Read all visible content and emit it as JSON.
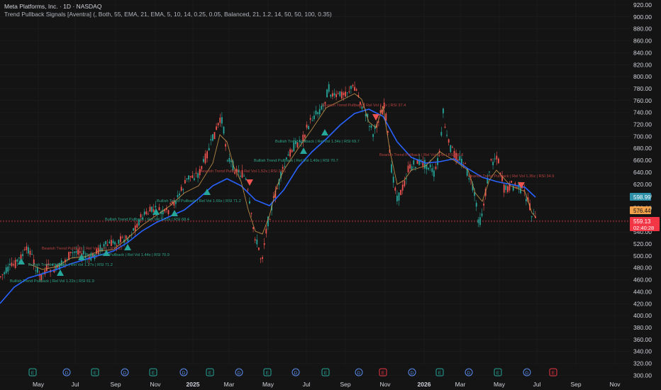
{
  "header": {
    "title": "Meta Platforms, Inc. · 1D · NASDAQ",
    "indicator": "Trend Pullback Signals [Aventra] (, Both, 55, EMA, 21, EMA, 5, 10, 14, 0.25, 0.05, Balanced, 21, 1.2, 14, 50, 50, 100, 0.35)"
  },
  "price_axis": {
    "ticks": [
      "920.00",
      "900.00",
      "880.00",
      "860.00",
      "840.00",
      "820.00",
      "800.00",
      "780.00",
      "760.00",
      "740.00",
      "720.00",
      "700.00",
      "680.00",
      "660.00",
      "640.00",
      "620.00",
      "600.00",
      "580.00",
      "560.00",
      "540.00",
      "520.00",
      "500.00",
      "480.00",
      "460.00",
      "440.00",
      "420.00",
      "400.00",
      "380.00",
      "360.00",
      "340.00",
      "320.00",
      "300.00"
    ],
    "badges": [
      {
        "text": "598.99",
        "color": "#2e8fa8"
      },
      {
        "text": "576.44",
        "color": "#f0a04a"
      },
      {
        "text": "559.13",
        "color": "#f23645"
      },
      {
        "text": "02:40:28",
        "color": "#f23645"
      }
    ]
  },
  "time_axis": {
    "labels": [
      "May",
      "Jul",
      "Sep",
      "Nov",
      "2025",
      "Mar",
      "May",
      "Jul",
      "Sep",
      "Nov",
      "2026",
      "Mar",
      "May",
      "Jul",
      "Sep",
      "Nov"
    ]
  },
  "events": [
    "E",
    "D",
    "E",
    "D",
    "E",
    "D",
    "E",
    "D",
    "E",
    "D",
    "E",
    "D",
    "E",
    "D",
    "E",
    "D",
    "E",
    "D",
    "E"
  ],
  "signals": [
    {
      "text": "Bearish Trend Pullback | Rel Vol 1.3x | RSI 37.4",
      "color": "#b9423f"
    },
    {
      "text": "Bullish Trend Pullback | Rel Vol 1.34x | RSI 69.7",
      "color": "#2ea58a"
    },
    {
      "text": "Bullish Trend Pullback | Rel Vol 1.49x | RSI 70.7",
      "color": "#2ea58a"
    },
    {
      "text": "Bearish Trend Pullback | Rel Vol 1.52x | RSI 29.1",
      "color": "#b9423f"
    },
    {
      "text": "Bullish Trend Pullback | Rel Vol 1.66x | RSI 71.2",
      "color": "#2ea58a"
    },
    {
      "text": "Bullish Trend Pullback | Rel Vol 1.53x | RSI 68.4",
      "color": "#2ea58a"
    },
    {
      "text": "Bullish Trend Pullback | Rel Vol 1.44x | RSI 70.9",
      "color": "#2ea58a"
    },
    {
      "text": "Bearish Trend Pullback | Rel Vol 1.3x | RSI 32",
      "color": "#b9423f"
    },
    {
      "text": "Bullish Trend Pullback | Rel Vol 1.27x | RSI 71.2",
      "color": "#2ea58a"
    },
    {
      "text": "Bullish Trend Pullback | Rel Vol 1.22x | RSI 61.9",
      "color": "#2ea58a"
    },
    {
      "text": "Bearish Trend Pullback | Rel Vol 1.4x | RSI 25.8",
      "color": "#b9423f"
    },
    {
      "text": "Bearish Trend Pullback | Rel Vol 1.35x | RSI 34.9",
      "color": "#b9423f"
    }
  ],
  "colors": {
    "up": "#26a69a",
    "down": "#ef5350",
    "ema_slow": "#2962ff",
    "ema_fast": "#f0a04a"
  }
}
